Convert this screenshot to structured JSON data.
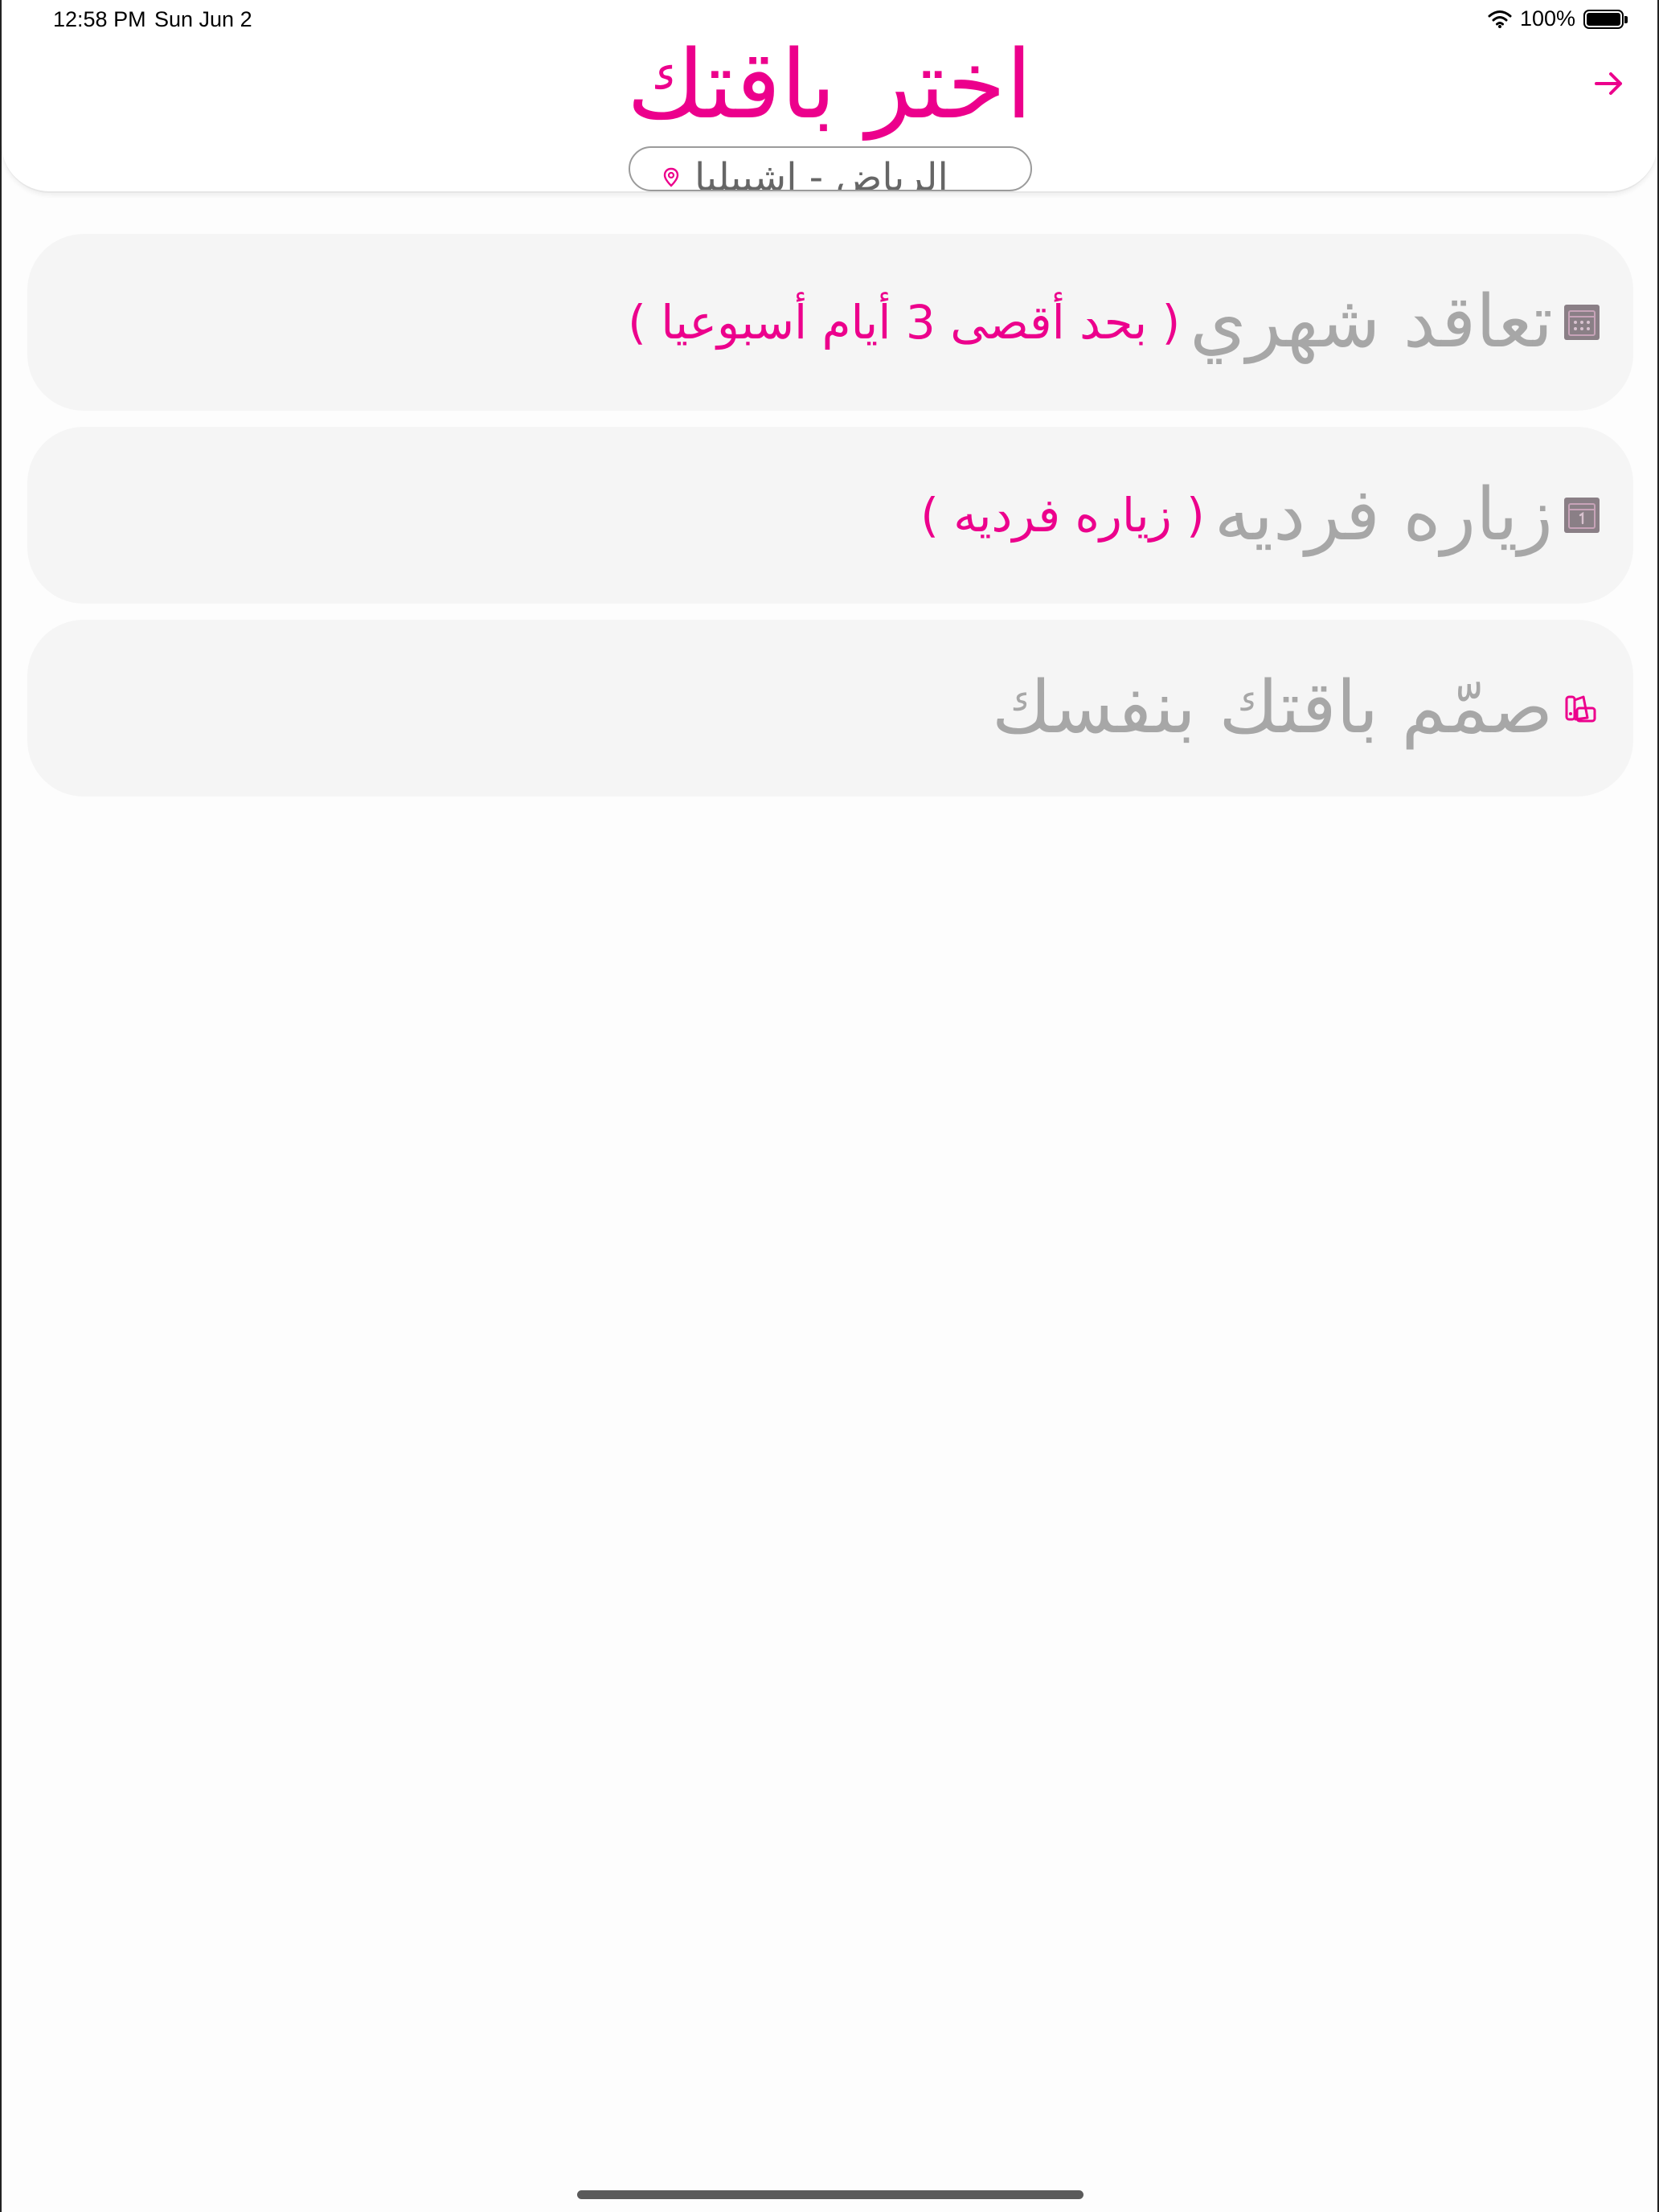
{
  "status_bar": {
    "time": "12:58 PM",
    "date": "Sun Jun 2",
    "battery": "100%",
    "battery_level": 1.0
  },
  "header": {
    "title": "اختر باقتك",
    "back_icon": "arrow-right-icon",
    "location": "الرياض - اشبيليا",
    "location_icon": "map-pin-icon"
  },
  "packages": [
    {
      "title": "تعاقد شهري",
      "note": "( بحد أقصى 3 أيام أسبوعيا )",
      "icon": "calendar-grid-icon"
    },
    {
      "title": "زياره فرديه",
      "note": "( زياره فرديه )",
      "icon": "calendar-single-day-icon"
    },
    {
      "title": "صمّم باقتك بنفسك",
      "note": "",
      "icon": "design-shapes-icon"
    }
  ],
  "colors": {
    "accent": "#ec008c",
    "card_bg": "#f5f5f5",
    "card_text": "#a7a7a7",
    "icon_box": "#8a7f86"
  }
}
